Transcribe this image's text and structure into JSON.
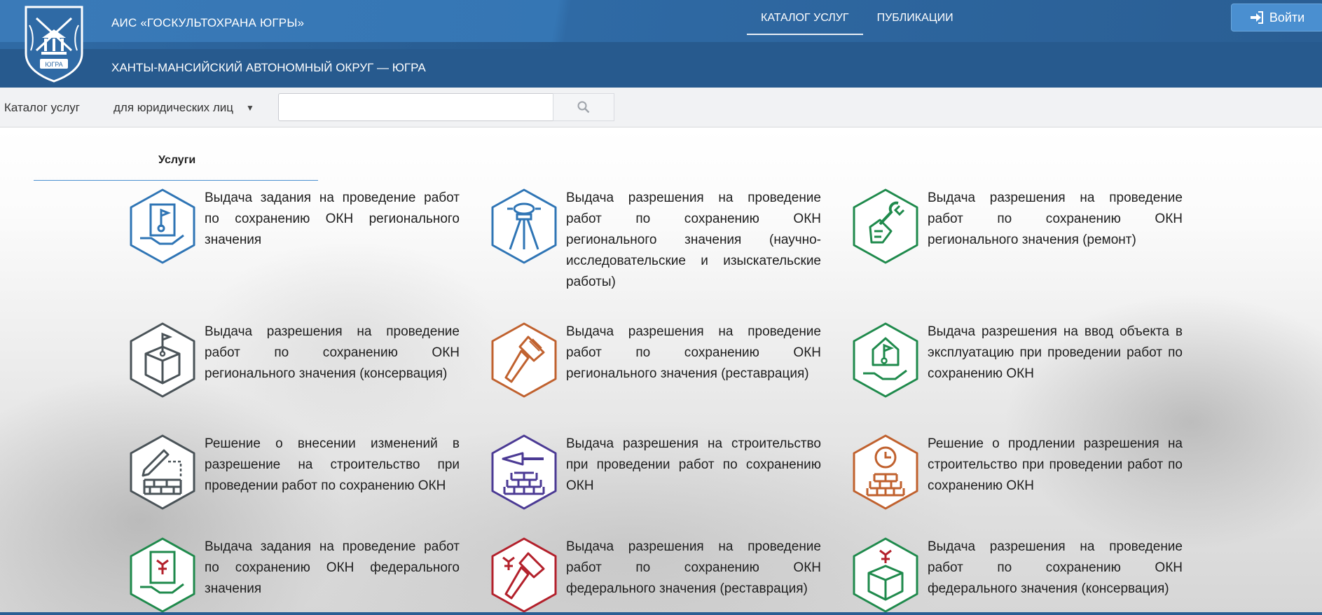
{
  "header": {
    "title": "АИС «ГОСКУЛЬТОХРАНА ЮГРЫ»",
    "subtitle": "ХАНТЫ-МАНСИЙСКИЙ АВТОНОМНЫЙ ОКРУГ — ЮГРА",
    "logo_text": "ЮГРА",
    "nav": [
      {
        "label": "КАТАЛОГ УСЛУГ",
        "active": true
      },
      {
        "label": "ПУБЛИКАЦИИ",
        "active": false
      }
    ],
    "login_label": "Войти"
  },
  "search_bar": {
    "catalog_label": "Каталог услуг",
    "audience_selected": "для юридических лиц",
    "search_value": "",
    "search_placeholder": ""
  },
  "tabs": {
    "services_label": "Услуги"
  },
  "services": [
    {
      "text": "Выдача задания на проведение работ по сохранению ОКН регионального значения",
      "icon": "document-flag-hand-icon",
      "color": "#2f75b5"
    },
    {
      "text": "Выдача разрешения на проведение работ по сохранению ОКН регионального значения (научно-исследовательские и изыскательские работы)",
      "icon": "theodolite-icon",
      "color": "#2f75b5"
    },
    {
      "text": "Выдача разрешения на проведение работ по сохранению ОКН регионального значения (ремонт)",
      "icon": "wrench-hand-icon",
      "color": "#1f8a4c"
    },
    {
      "text": "Выдача разрешения на проведение работ по сохранению ОКН регионального значения (консервация)",
      "icon": "box-flag-icon",
      "color": "#4a5358"
    },
    {
      "text": "Выдача разрешения на проведение работ по сохранению ОКН регионального значения (реставрация)",
      "icon": "paintbrush-icon",
      "color": "#c0612e"
    },
    {
      "text": "Выдача разрешения на ввод объекта в эксплуатацию при проведении работ по сохранению ОКН",
      "icon": "house-flag-hand-icon",
      "color": "#1f8a4c"
    },
    {
      "text": "Решение о внесении изменений в разрешение на строительство при проведении работ по сохранению ОКН",
      "icon": "bricks-pencil-icon",
      "color": "#4a5358"
    },
    {
      "text": "Выдача разрешения на строительство при проведении работ по сохранению ОКН",
      "icon": "trowel-bricks-icon",
      "color": "#4b3a94"
    },
    {
      "text": "Решение о продлении разрешения на строительство при проведении работ по сохранению ОКН",
      "icon": "clock-bricks-icon",
      "color": "#c0612e"
    },
    {
      "text": "Выдача задания на проведение работ по сохранению ОКН федерального значения",
      "icon": "document-eagle-hand-icon",
      "color": "#1f8a4c"
    },
    {
      "text": "Выдача разрешения на проведение работ по сохранению ОКН федерального значения (реставрация)",
      "icon": "eagle-paintbrush-icon",
      "color": "#b3202b"
    },
    {
      "text": "Выдача разрешения на проведение работ по сохранению ОКН федерального значения (консервация)",
      "icon": "eagle-box-icon",
      "color": "#1f8a4c"
    }
  ]
}
